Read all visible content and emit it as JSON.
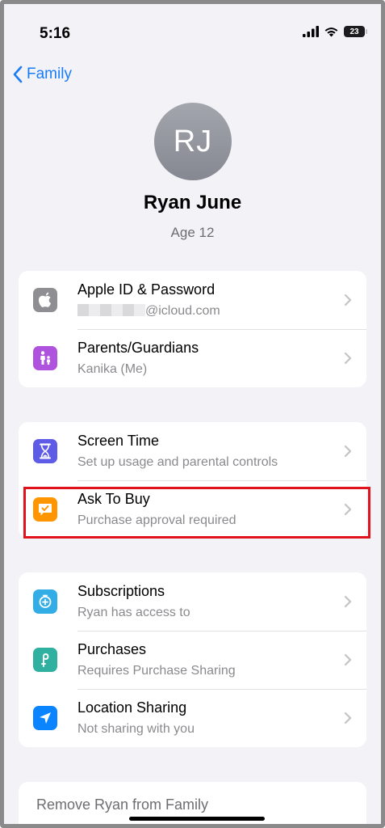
{
  "status_bar": {
    "time": "5:16",
    "battery": "23"
  },
  "nav": {
    "back_label": "Family"
  },
  "profile": {
    "initials": "RJ",
    "name": "Ryan June",
    "age": "Age 12"
  },
  "account_group": [
    {
      "title": "Apple ID & Password",
      "subtitle": "@icloud.com",
      "icon": "apple-logo-icon",
      "color": "#8e8e93"
    },
    {
      "title": "Parents/Guardians",
      "subtitle": "Kanika (Me)",
      "icon": "family-icon",
      "color": "#af52de"
    }
  ],
  "controls_group": [
    {
      "title": "Screen Time",
      "subtitle": "Set up usage and parental controls",
      "icon": "hourglass-icon",
      "color": "#5e5ce6"
    },
    {
      "title": "Ask To Buy",
      "subtitle": "Purchase approval required",
      "icon": "ask-to-buy-icon",
      "color": "#ff9500"
    }
  ],
  "sharing_group": [
    {
      "title": "Subscriptions",
      "subtitle": "Ryan has access to",
      "icon": "subscriptions-icon",
      "color": "#32ade6"
    },
    {
      "title": "Purchases",
      "subtitle": "Requires Purchase Sharing",
      "icon": "purchases-icon",
      "color": "#30b0a0"
    },
    {
      "title": "Location Sharing",
      "subtitle": "Not sharing with you",
      "icon": "location-arrow-icon",
      "color": "#0a84ff"
    }
  ],
  "remove": {
    "label": "Remove Ryan from Family"
  },
  "colors": {
    "accent": "#1a7cf5",
    "highlight": "#e0121b",
    "background": "#f2f2f7"
  }
}
